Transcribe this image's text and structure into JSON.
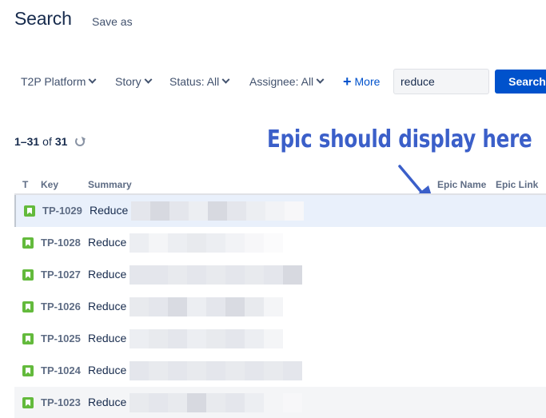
{
  "header": {
    "title": "Search",
    "save_as": "Save as"
  },
  "filters": {
    "project": "T2P Platform",
    "type": "Story",
    "status": "Status: All",
    "assignee": "Assignee: All",
    "more": "More",
    "search_value": "reduce",
    "search_button": "Search"
  },
  "results": {
    "range": "1–31",
    "of": "of",
    "total": "31"
  },
  "annotation": "Epic should display here",
  "table": {
    "columns": {
      "type": "T",
      "key": "Key",
      "summary": "Summary",
      "epic_name": "Epic Name",
      "epic_link": "Epic Link"
    },
    "rows": [
      {
        "key": "TP-1029",
        "summary": "Reduce"
      },
      {
        "key": "TP-1028",
        "summary": "Reduce"
      },
      {
        "key": "TP-1027",
        "summary": "Reduce"
      },
      {
        "key": "TP-1026",
        "summary": "Reduce"
      },
      {
        "key": "TP-1025",
        "summary": "Reduce"
      },
      {
        "key": "TP-1024",
        "summary": "Reduce"
      },
      {
        "key": "TP-1023",
        "summary": "Reduce"
      }
    ]
  },
  "colors": {
    "accent": "#0052cc",
    "annotation": "#3b5fc9",
    "story_icon": "#63ba3c",
    "selected_row": "#e9f0fb"
  },
  "icons": {
    "story": "story-icon",
    "refresh": "refresh-icon",
    "arrow": "arrow-icon"
  }
}
